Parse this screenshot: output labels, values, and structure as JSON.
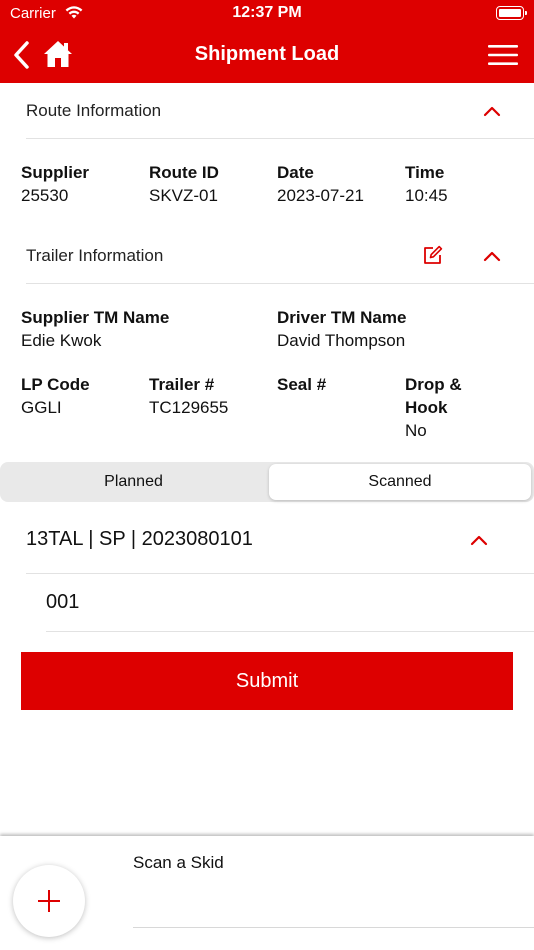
{
  "status_bar": {
    "carrier": "Carrier",
    "time": "12:37 PM"
  },
  "nav": {
    "title": "Shipment Load"
  },
  "route_info": {
    "header": "Route Information",
    "fields": [
      {
        "label": "Supplier",
        "value": "25530"
      },
      {
        "label": "Route ID",
        "value": "SKVZ-01"
      },
      {
        "label": "Date",
        "value": "2023-07-21"
      },
      {
        "label": "Time",
        "value": "10:45"
      }
    ]
  },
  "trailer_info": {
    "header": "Trailer Information",
    "supplier_tm": {
      "label": "Supplier TM Name",
      "value": "Edie Kwok"
    },
    "driver_tm": {
      "label": "Driver TM Name",
      "value": "David Thompson"
    },
    "lp_code": {
      "label": "LP Code",
      "value": "GGLI"
    },
    "trailer_no": {
      "label": "Trailer #",
      "value": "TC129655"
    },
    "seal_no": {
      "label": "Seal #",
      "value": ""
    },
    "drop_hook": {
      "label_line1": "Drop &",
      "label_line2": "Hook",
      "value": "No"
    }
  },
  "segmented": {
    "planned": "Planned",
    "scanned": "Scanned",
    "selected": "Scanned"
  },
  "group": {
    "label": "13TAL | SP | 2023080101"
  },
  "item": {
    "label": "001"
  },
  "submit_label": "Submit",
  "bottom": {
    "scan_label": "Scan a Skid"
  },
  "colors": {
    "brand": "#dd0000",
    "background": "#ffffff",
    "divider": "#e2e2e2"
  },
  "icons": [
    "wifi-icon",
    "battery-icon",
    "back-icon",
    "home-icon",
    "menu-icon",
    "chevron-up-icon",
    "edit-icon",
    "plus-icon"
  ]
}
